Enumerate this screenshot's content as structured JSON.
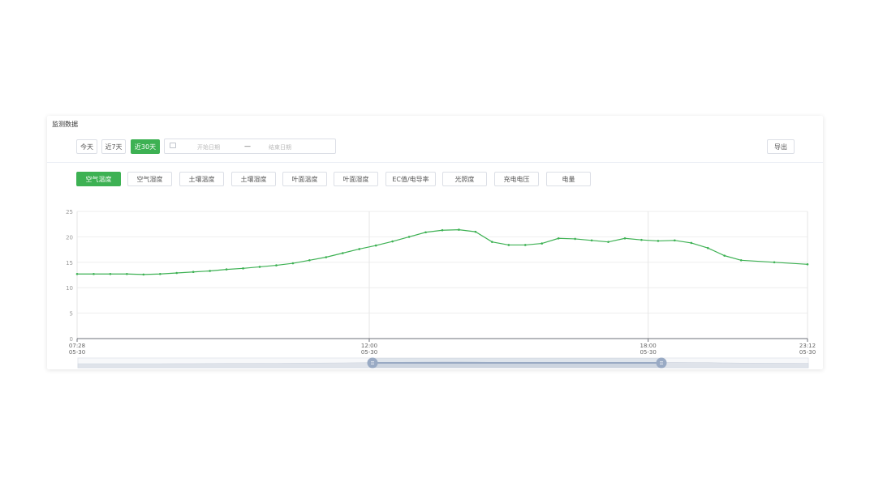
{
  "panel": {
    "title": "监测数据"
  },
  "range_buttons": [
    {
      "label": "今天",
      "active": false
    },
    {
      "label": "近7天",
      "active": false
    },
    {
      "label": "近30天",
      "active": true
    }
  ],
  "date_range": {
    "start_placeholder": "开始日期",
    "separator": "—",
    "end_placeholder": "结束日期"
  },
  "export_label": "导出",
  "metric_tabs": [
    {
      "label": "空气温度",
      "active": true
    },
    {
      "label": "空气湿度",
      "active": false
    },
    {
      "label": "土壤温度",
      "active": false
    },
    {
      "label": "土壤湿度",
      "active": false
    },
    {
      "label": "叶面温度",
      "active": false
    },
    {
      "label": "叶面湿度",
      "active": false
    },
    {
      "label": "EC值/电导率",
      "active": false
    },
    {
      "label": "光照度",
      "active": false
    },
    {
      "label": "充电电压",
      "active": false
    },
    {
      "label": "电量",
      "active": false
    }
  ],
  "colors": {
    "accent": "#3db153",
    "line": "#3db153",
    "slider": "#99aac4"
  },
  "chart_data": {
    "type": "line",
    "title": "",
    "xlabel": "",
    "ylabel": "",
    "ylim": [
      0,
      25
    ],
    "yticks": [
      "0",
      "5",
      "10",
      "15",
      "20",
      "25"
    ],
    "xrange": [
      0,
      22
    ],
    "xticks": [
      {
        "t": 0,
        "line1": "07:28",
        "line2": "05-30"
      },
      {
        "t": 8.8,
        "line1": "12:00",
        "line2": "05-30"
      },
      {
        "t": 17.2,
        "line1": "18:00",
        "line2": "05-30"
      },
      {
        "t": 22,
        "line1": "23:12",
        "line2": "05-30"
      }
    ],
    "series": [
      {
        "x": [
          0,
          0.5,
          1,
          1.5,
          2,
          2.5,
          3,
          3.5,
          4,
          4.5,
          5,
          5.5,
          6,
          6.5,
          7,
          7.5,
          8,
          8.5,
          9,
          9.5,
          10,
          10.5,
          11,
          11.5,
          12,
          12.5,
          13,
          13.5,
          14,
          14.5,
          15,
          15.5,
          16,
          16.5,
          17,
          17.5,
          18,
          18.5,
          19,
          19.5,
          20,
          21,
          22
        ],
        "y": [
          12.7,
          12.7,
          12.7,
          12.7,
          12.6,
          12.7,
          12.9,
          13.1,
          13.3,
          13.6,
          13.8,
          14.1,
          14.4,
          14.8,
          15.4,
          16.0,
          16.8,
          17.6,
          18.3,
          19.1,
          20.0,
          20.9,
          21.3,
          21.4,
          21.0,
          19.0,
          18.4,
          18.4,
          18.7,
          19.7,
          19.6,
          19.3,
          19.0,
          19.7,
          19.4,
          19.2,
          19.3,
          18.8,
          17.8,
          16.3,
          15.4,
          15.0,
          14.6
        ]
      }
    ]
  }
}
